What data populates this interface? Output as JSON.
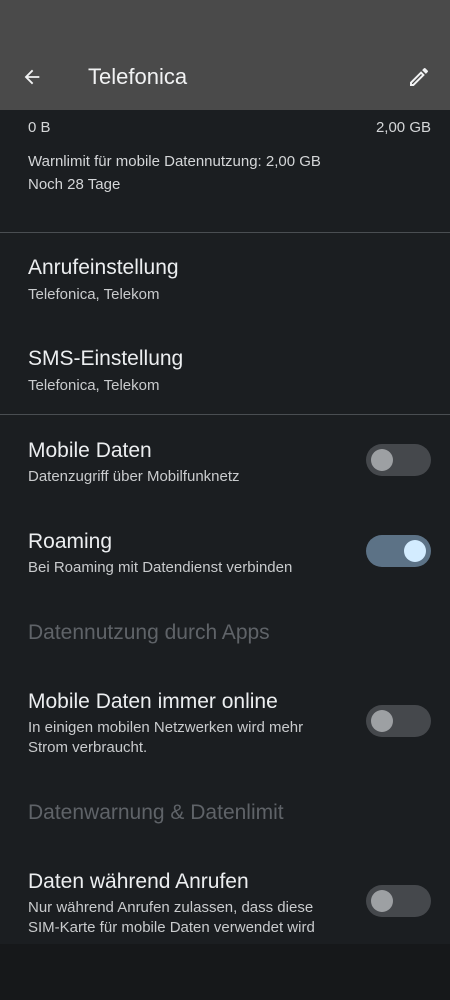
{
  "app_bar": {
    "title": "Telefonica"
  },
  "usage": {
    "min_label": "0 B",
    "max_label": "2,00 GB",
    "warning_text": "Warnlimit für mobile Datennutzung: 2,00 GB",
    "days_left": "Noch 28 Tage"
  },
  "call_setting": {
    "title": "Anrufeinstellung",
    "subtitle": "Telefonica, Telekom"
  },
  "sms_setting": {
    "title": "SMS-Einstellung",
    "subtitle": "Telefonica, Telekom"
  },
  "mobile_data": {
    "title": "Mobile Daten",
    "subtitle": "Datenzugriff über Mobilfunknetz",
    "enabled": false
  },
  "roaming": {
    "title": "Roaming",
    "subtitle": "Bei Roaming mit Datendienst verbinden",
    "enabled": true
  },
  "section_app_usage": {
    "label": "Datennutzung durch Apps"
  },
  "always_online": {
    "title": "Mobile Daten immer online",
    "subtitle_line1": "In einigen mobilen Netzwerken wird mehr",
    "subtitle_line2": "Strom verbraucht.",
    "enabled": false
  },
  "section_warning_limit": {
    "label": "Datenwarnung & Datenlimit"
  },
  "data_during_calls": {
    "title": "Daten während Anrufen",
    "subtitle_line1": "Nur während Anrufen zulassen, dass diese",
    "subtitle_line2": "SIM-Karte für mobile Daten verwendet wird",
    "enabled": false
  },
  "colors": {
    "background": "#1b1e21",
    "app_bar": "#4a4a4a",
    "toggle_on_track": "#5c7286",
    "toggle_on_knob": "#d3ecff",
    "toggle_off_track": "#45484c",
    "toggle_off_knob": "#9da0a3"
  },
  "icons": {
    "back": "arrow-left-icon",
    "edit": "pencil-icon"
  }
}
